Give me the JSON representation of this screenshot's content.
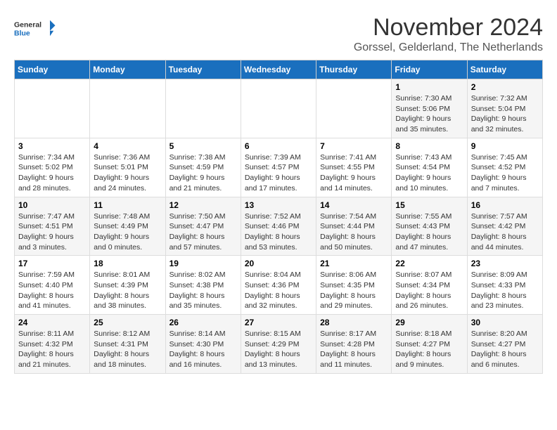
{
  "logo": {
    "text_general": "General",
    "text_blue": "Blue"
  },
  "title": "November 2024",
  "location": "Gorssel, Gelderland, The Netherlands",
  "days_of_week": [
    "Sunday",
    "Monday",
    "Tuesday",
    "Wednesday",
    "Thursday",
    "Friday",
    "Saturday"
  ],
  "weeks": [
    [
      {
        "day": "",
        "info": ""
      },
      {
        "day": "",
        "info": ""
      },
      {
        "day": "",
        "info": ""
      },
      {
        "day": "",
        "info": ""
      },
      {
        "day": "",
        "info": ""
      },
      {
        "day": "1",
        "info": "Sunrise: 7:30 AM\nSunset: 5:06 PM\nDaylight: 9 hours and 35 minutes."
      },
      {
        "day": "2",
        "info": "Sunrise: 7:32 AM\nSunset: 5:04 PM\nDaylight: 9 hours and 32 minutes."
      }
    ],
    [
      {
        "day": "3",
        "info": "Sunrise: 7:34 AM\nSunset: 5:02 PM\nDaylight: 9 hours and 28 minutes."
      },
      {
        "day": "4",
        "info": "Sunrise: 7:36 AM\nSunset: 5:01 PM\nDaylight: 9 hours and 24 minutes."
      },
      {
        "day": "5",
        "info": "Sunrise: 7:38 AM\nSunset: 4:59 PM\nDaylight: 9 hours and 21 minutes."
      },
      {
        "day": "6",
        "info": "Sunrise: 7:39 AM\nSunset: 4:57 PM\nDaylight: 9 hours and 17 minutes."
      },
      {
        "day": "7",
        "info": "Sunrise: 7:41 AM\nSunset: 4:55 PM\nDaylight: 9 hours and 14 minutes."
      },
      {
        "day": "8",
        "info": "Sunrise: 7:43 AM\nSunset: 4:54 PM\nDaylight: 9 hours and 10 minutes."
      },
      {
        "day": "9",
        "info": "Sunrise: 7:45 AM\nSunset: 4:52 PM\nDaylight: 9 hours and 7 minutes."
      }
    ],
    [
      {
        "day": "10",
        "info": "Sunrise: 7:47 AM\nSunset: 4:51 PM\nDaylight: 9 hours and 3 minutes."
      },
      {
        "day": "11",
        "info": "Sunrise: 7:48 AM\nSunset: 4:49 PM\nDaylight: 9 hours and 0 minutes."
      },
      {
        "day": "12",
        "info": "Sunrise: 7:50 AM\nSunset: 4:47 PM\nDaylight: 8 hours and 57 minutes."
      },
      {
        "day": "13",
        "info": "Sunrise: 7:52 AM\nSunset: 4:46 PM\nDaylight: 8 hours and 53 minutes."
      },
      {
        "day": "14",
        "info": "Sunrise: 7:54 AM\nSunset: 4:44 PM\nDaylight: 8 hours and 50 minutes."
      },
      {
        "day": "15",
        "info": "Sunrise: 7:55 AM\nSunset: 4:43 PM\nDaylight: 8 hours and 47 minutes."
      },
      {
        "day": "16",
        "info": "Sunrise: 7:57 AM\nSunset: 4:42 PM\nDaylight: 8 hours and 44 minutes."
      }
    ],
    [
      {
        "day": "17",
        "info": "Sunrise: 7:59 AM\nSunset: 4:40 PM\nDaylight: 8 hours and 41 minutes."
      },
      {
        "day": "18",
        "info": "Sunrise: 8:01 AM\nSunset: 4:39 PM\nDaylight: 8 hours and 38 minutes."
      },
      {
        "day": "19",
        "info": "Sunrise: 8:02 AM\nSunset: 4:38 PM\nDaylight: 8 hours and 35 minutes."
      },
      {
        "day": "20",
        "info": "Sunrise: 8:04 AM\nSunset: 4:36 PM\nDaylight: 8 hours and 32 minutes."
      },
      {
        "day": "21",
        "info": "Sunrise: 8:06 AM\nSunset: 4:35 PM\nDaylight: 8 hours and 29 minutes."
      },
      {
        "day": "22",
        "info": "Sunrise: 8:07 AM\nSunset: 4:34 PM\nDaylight: 8 hours and 26 minutes."
      },
      {
        "day": "23",
        "info": "Sunrise: 8:09 AM\nSunset: 4:33 PM\nDaylight: 8 hours and 23 minutes."
      }
    ],
    [
      {
        "day": "24",
        "info": "Sunrise: 8:11 AM\nSunset: 4:32 PM\nDaylight: 8 hours and 21 minutes."
      },
      {
        "day": "25",
        "info": "Sunrise: 8:12 AM\nSunset: 4:31 PM\nDaylight: 8 hours and 18 minutes."
      },
      {
        "day": "26",
        "info": "Sunrise: 8:14 AM\nSunset: 4:30 PM\nDaylight: 8 hours and 16 minutes."
      },
      {
        "day": "27",
        "info": "Sunrise: 8:15 AM\nSunset: 4:29 PM\nDaylight: 8 hours and 13 minutes."
      },
      {
        "day": "28",
        "info": "Sunrise: 8:17 AM\nSunset: 4:28 PM\nDaylight: 8 hours and 11 minutes."
      },
      {
        "day": "29",
        "info": "Sunrise: 8:18 AM\nSunset: 4:27 PM\nDaylight: 8 hours and 9 minutes."
      },
      {
        "day": "30",
        "info": "Sunrise: 8:20 AM\nSunset: 4:27 PM\nDaylight: 8 hours and 6 minutes."
      }
    ]
  ]
}
